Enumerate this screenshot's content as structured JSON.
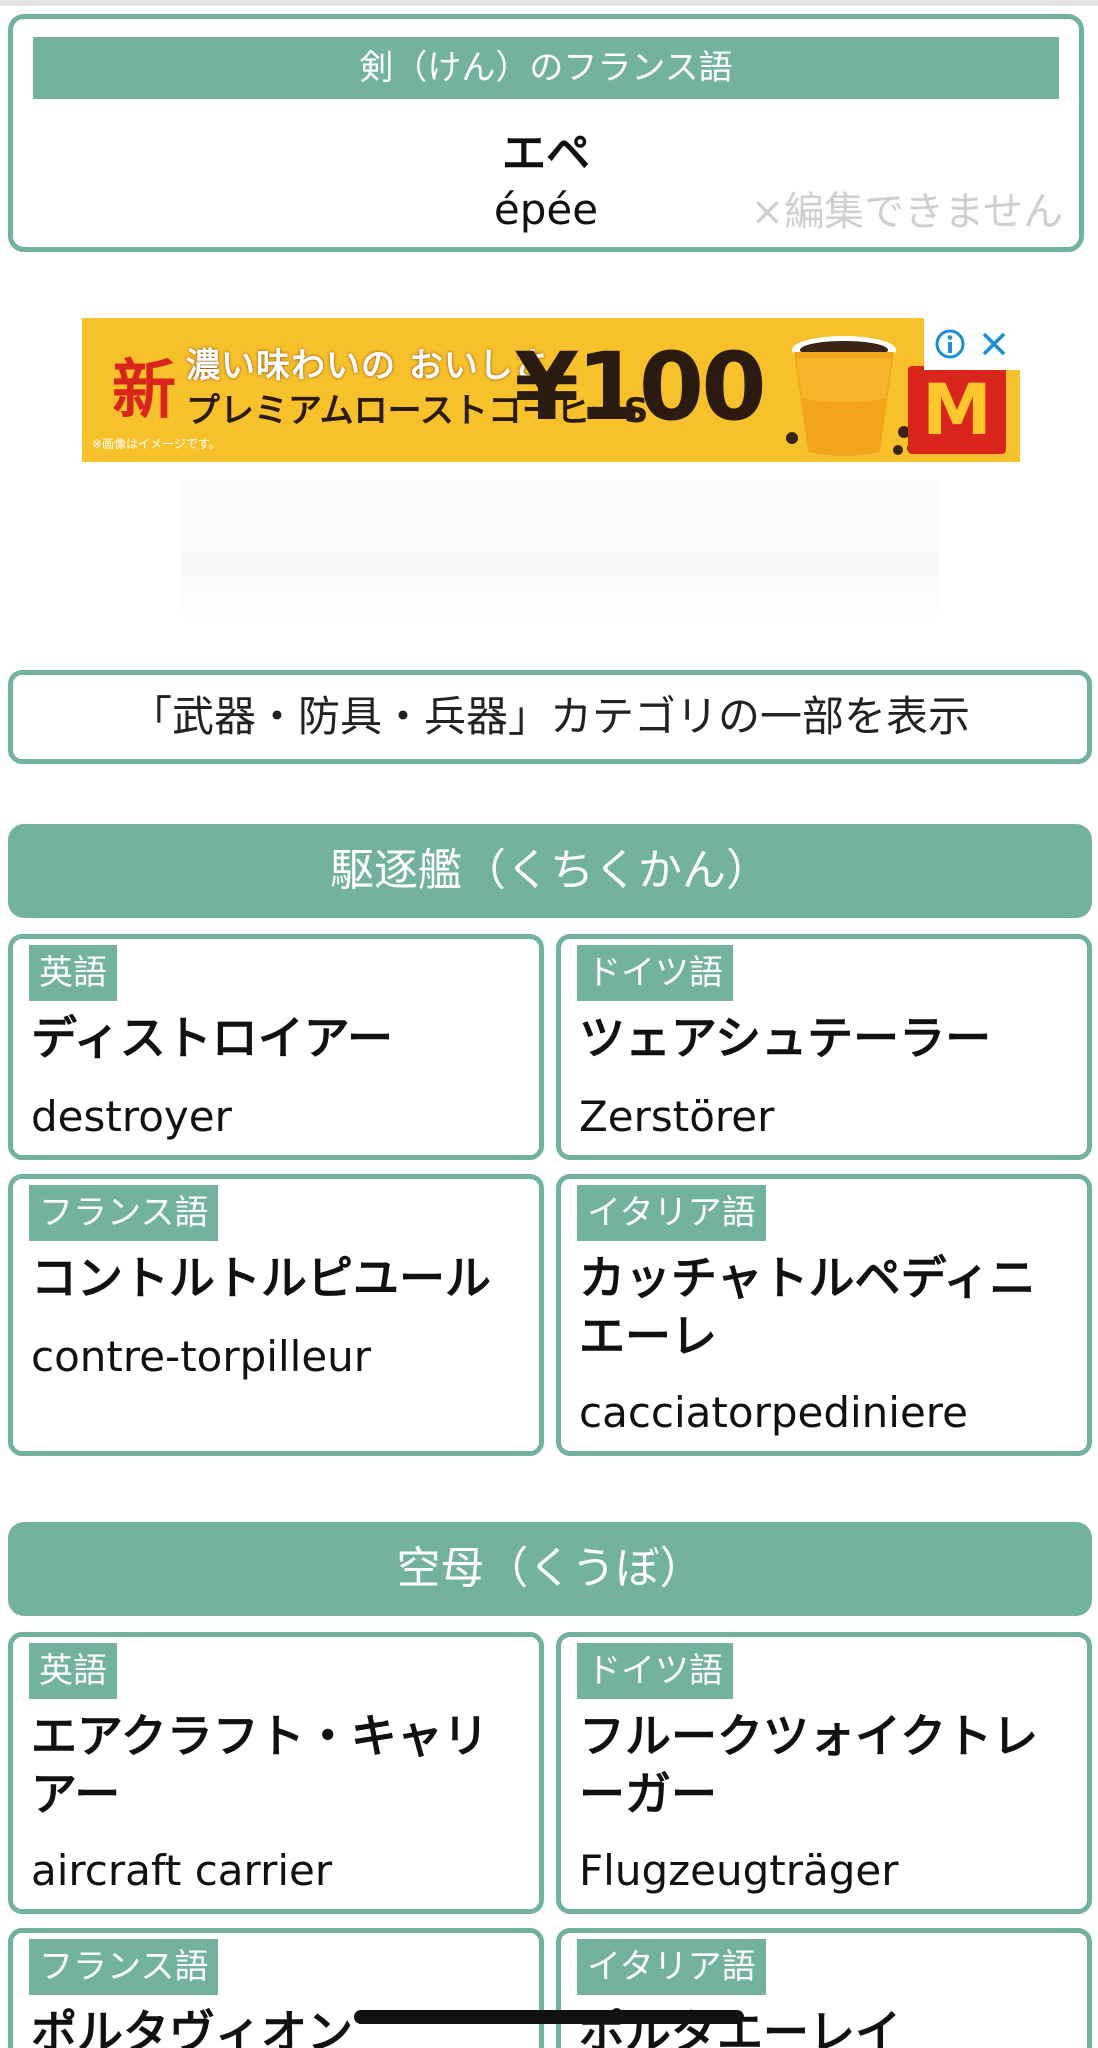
{
  "result": {
    "header": "剣（けん）のフランス語",
    "kana": "エペ",
    "word": "épée",
    "note": "×編集できません"
  },
  "ad": {
    "new_label": "新",
    "headline": "濃い味わいの おいしさ。",
    "product": "プレミアムローストコーヒーS",
    "price": "¥100",
    "fine_print": "※画像はイメージです。",
    "logo_letter": "M",
    "brand_color": "#d9251c",
    "background_color": "#f7c12c"
  },
  "category": {
    "label": "「武器・防具・兵器」カテゴリの一部を表示"
  },
  "groups": [
    {
      "header": "駆逐艦（くちくかん）",
      "cards": [
        {
          "lang": "英語",
          "kana": "ディストロイアー",
          "roman": "destroyer"
        },
        {
          "lang": "ドイツ語",
          "kana": "ツェアシュテーラー",
          "roman": "Zerstörer"
        },
        {
          "lang": "フランス語",
          "kana": "コントルトルピユール",
          "roman": "contre-torpilleur"
        },
        {
          "lang": "イタリア語",
          "kana": "カッチャトルペディニエーレ",
          "roman": "cacciatorpediniere"
        }
      ]
    },
    {
      "header": "空母（くうぼ）",
      "cards": [
        {
          "lang": "英語",
          "kana": "エアクラフト・キャリアー",
          "roman": "aircraft carrier"
        },
        {
          "lang": "ドイツ語",
          "kana": "フルークツォイクトレーガー",
          "roman": "Flugzeugträger"
        },
        {
          "lang": "フランス語",
          "kana": "ポルタヴィオン",
          "roman": ""
        },
        {
          "lang": "イタリア語",
          "kana": "ポルタエーレイ",
          "roman": ""
        }
      ]
    }
  ],
  "theme": {
    "accent_color": "#73b39d"
  }
}
